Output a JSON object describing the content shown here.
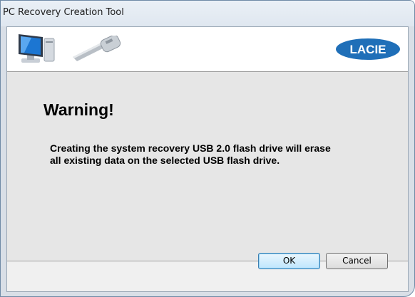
{
  "window": {
    "title": "PC Recovery Creation Tool"
  },
  "banner": {
    "icons": [
      "computer-icon",
      "usb-key-icon"
    ],
    "logo_text": "LACIE"
  },
  "content": {
    "heading": "Warning!",
    "message": "Creating the system recovery USB 2.0 flash drive will erase all existing data on the selected USB flash drive."
  },
  "buttons": {
    "ok_label": "OK",
    "cancel_label": "Cancel"
  },
  "colors": {
    "logo_blue": "#1f6fb8",
    "frame_border": "#6f8aa6",
    "content_bg": "#e6e6e6"
  }
}
